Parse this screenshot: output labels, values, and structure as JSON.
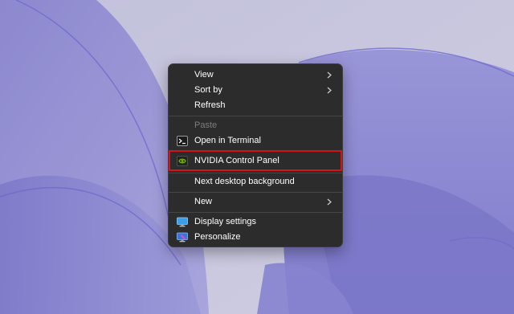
{
  "context_menu": {
    "items": [
      {
        "label": "View",
        "submenu": true
      },
      {
        "label": "Sort by",
        "submenu": true
      },
      {
        "label": "Refresh"
      },
      {
        "label": "Paste",
        "disabled": true
      },
      {
        "label": "Open in Terminal",
        "icon": "terminal-icon"
      },
      {
        "label": "NVIDIA Control Panel",
        "icon": "nvidia-icon",
        "highlighted": true
      },
      {
        "label": "Next desktop background"
      },
      {
        "label": "New",
        "submenu": true
      },
      {
        "label": "Display settings",
        "icon": "display-icon"
      },
      {
        "label": "Personalize",
        "icon": "personalize-icon"
      }
    ]
  },
  "colors": {
    "menu_background": "#2c2c2c",
    "highlight_border": "#d3141b",
    "wallpaper_base": "#b9b6d6",
    "wallpaper_petal": "#8f8cd6"
  }
}
